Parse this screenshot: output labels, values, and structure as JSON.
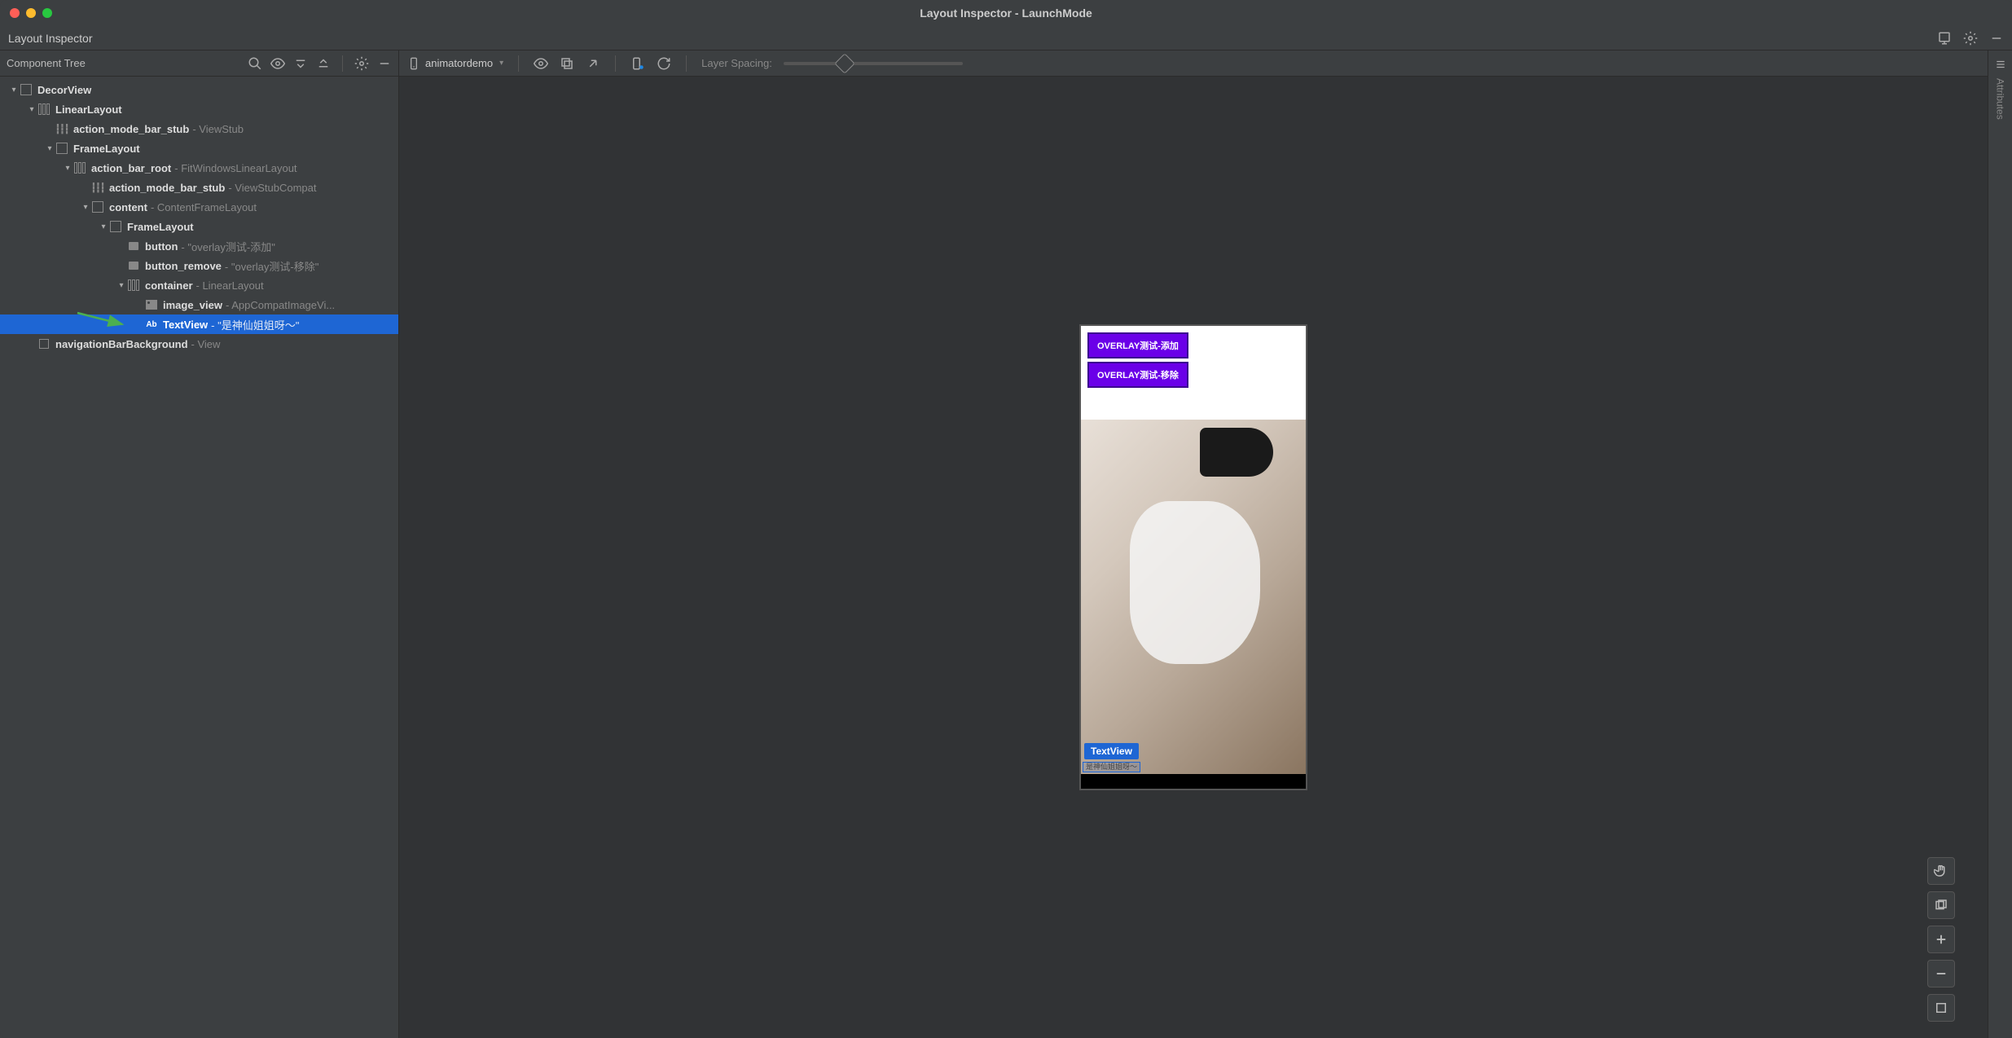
{
  "window": {
    "title": "Layout Inspector - LaunchMode"
  },
  "subtitle": "Layout Inspector",
  "leftPanel": {
    "title": "Component Tree"
  },
  "toolbar": {
    "device": "animatordemo",
    "layerSpacing": "Layer Spacing:"
  },
  "tree": [
    {
      "depth": 0,
      "chev": "▾",
      "icon": "frame",
      "name": "DecorView",
      "suffix": ""
    },
    {
      "depth": 1,
      "chev": "▾",
      "icon": "cols",
      "name": "LinearLayout",
      "suffix": ""
    },
    {
      "depth": 2,
      "chev": "",
      "icon": "dots",
      "name": "action_mode_bar_stub",
      "suffix": " - ViewStub"
    },
    {
      "depth": 2,
      "chev": "▾",
      "icon": "frame",
      "name": "FrameLayout",
      "suffix": ""
    },
    {
      "depth": 3,
      "chev": "▾",
      "icon": "cols",
      "name": "action_bar_root",
      "suffix": " - FitWindowsLinearLayout"
    },
    {
      "depth": 4,
      "chev": "",
      "icon": "dots",
      "name": "action_mode_bar_stub",
      "suffix": " - ViewStubCompat"
    },
    {
      "depth": 4,
      "chev": "▾",
      "icon": "frame",
      "name": "content",
      "suffix": " - ContentFrameLayout"
    },
    {
      "depth": 5,
      "chev": "▾",
      "icon": "frame",
      "name": "FrameLayout",
      "suffix": ""
    },
    {
      "depth": 6,
      "chev": "",
      "icon": "box",
      "name": "button",
      "suffix": " - \"overlay测试-添加\""
    },
    {
      "depth": 6,
      "chev": "",
      "icon": "box",
      "name": "button_remove",
      "suffix": " - \"overlay测试-移除\""
    },
    {
      "depth": 6,
      "chev": "▾",
      "icon": "cols",
      "name": "container",
      "suffix": " - LinearLayout"
    },
    {
      "depth": 7,
      "chev": "",
      "icon": "img",
      "name": "image_view",
      "suffix": " - AppCompatImageVi..."
    },
    {
      "depth": 7,
      "chev": "",
      "icon": "ab",
      "name": "TextView",
      "suffix": " - \"是神仙姐姐呀～\"",
      "selected": true,
      "arrow": true
    },
    {
      "depth": 1,
      "chev": "",
      "icon": "sq",
      "name": "navigationBarBackground",
      "suffix": " - View"
    }
  ],
  "preview": {
    "btn1": "OVERLAY测试-添加",
    "btn2": "OVERLAY测试-移除",
    "tvLabel": "TextView",
    "tvText": "是神仙姐姐呀～"
  },
  "rightRail": "Attributes"
}
